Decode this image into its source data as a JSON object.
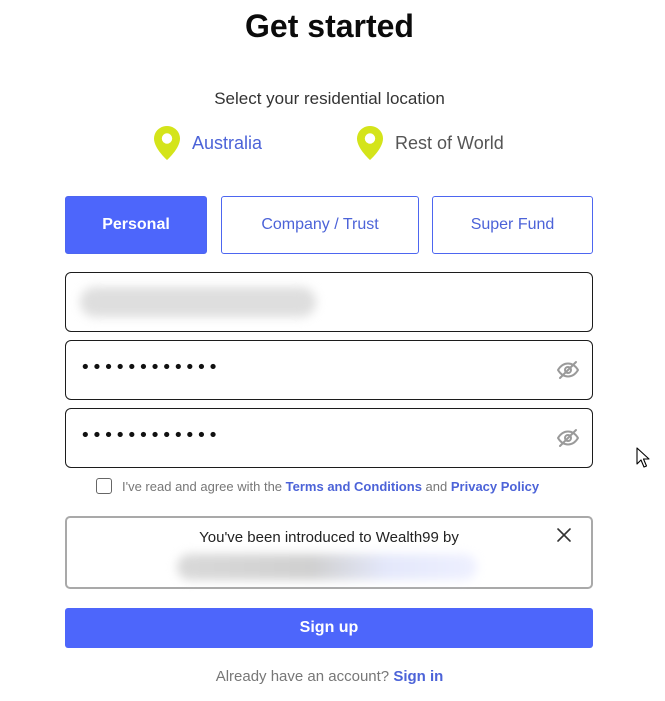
{
  "page": {
    "title": "Get started"
  },
  "location": {
    "label": "Select your residential location",
    "options": [
      {
        "label": "Australia",
        "selected": true
      },
      {
        "label": "Rest of World",
        "selected": false
      }
    ],
    "pin_color": "#d4e41a"
  },
  "account_types": {
    "tabs": [
      {
        "label": "Personal",
        "active": true
      },
      {
        "label": "Company / Trust",
        "active": false
      },
      {
        "label": "Super Fund",
        "active": false
      }
    ],
    "accent": "#4d66fb"
  },
  "form": {
    "email": {
      "value_state": "redacted"
    },
    "password": {
      "value": "••••••••••••",
      "icon": "eye-off-icon"
    },
    "confirm_password": {
      "value": "••••••••••••",
      "icon": "eye-off-icon"
    }
  },
  "terms": {
    "prefix": "I've read and agree with the",
    "terms_link": "Terms and Conditions",
    "conjunction": "and",
    "privacy_link": "Privacy Policy",
    "checked": false
  },
  "introduction": {
    "text": "You've been introduced to Wealth99 by",
    "referrer_state": "redacted",
    "close_icon": "close-icon"
  },
  "actions": {
    "signup_label": "Sign up",
    "signin_prompt": "Already have an account?",
    "signin_link": "Sign in"
  }
}
